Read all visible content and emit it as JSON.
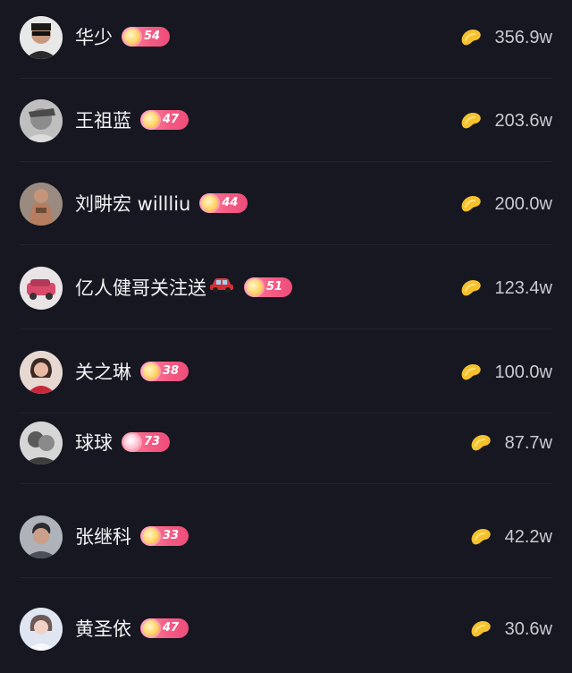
{
  "rows": [
    {
      "name": "华少",
      "level": "54",
      "score": "356.9w",
      "avatar_color": "#555"
    },
    {
      "name": "王祖蓝",
      "level": "47",
      "score": "203.6w",
      "avatar_color": "#9a9a9a"
    },
    {
      "name": "刘畊宏 willliu",
      "level": "44",
      "score": "200.0w",
      "avatar_color": "#7b6a60"
    },
    {
      "name": "亿人健哥关注送",
      "level": "51",
      "score": "123.4w",
      "avatar_color": "#c9b9b5"
    },
    {
      "name": "关之琳",
      "level": "38",
      "score": "100.0w",
      "avatar_color": "#b56b6b"
    },
    {
      "name": "球球",
      "level": "73",
      "score": "87.7w",
      "avatar_color": "#6f6f6f"
    },
    {
      "name": "张继科",
      "level": "33",
      "score": "42.2w",
      "avatar_color": "#8b8e95"
    },
    {
      "name": "黄圣依",
      "level": "47",
      "score": "30.6w",
      "avatar_color": "#cfd8e6"
    }
  ],
  "colors": {
    "background": "#161720",
    "badge": "#f45b84",
    "bean": "#f5c12e"
  },
  "icons": {
    "bean": "gold-bean-icon",
    "car": "car-emoji-icon",
    "gem": "fan-level-gem-icon"
  }
}
